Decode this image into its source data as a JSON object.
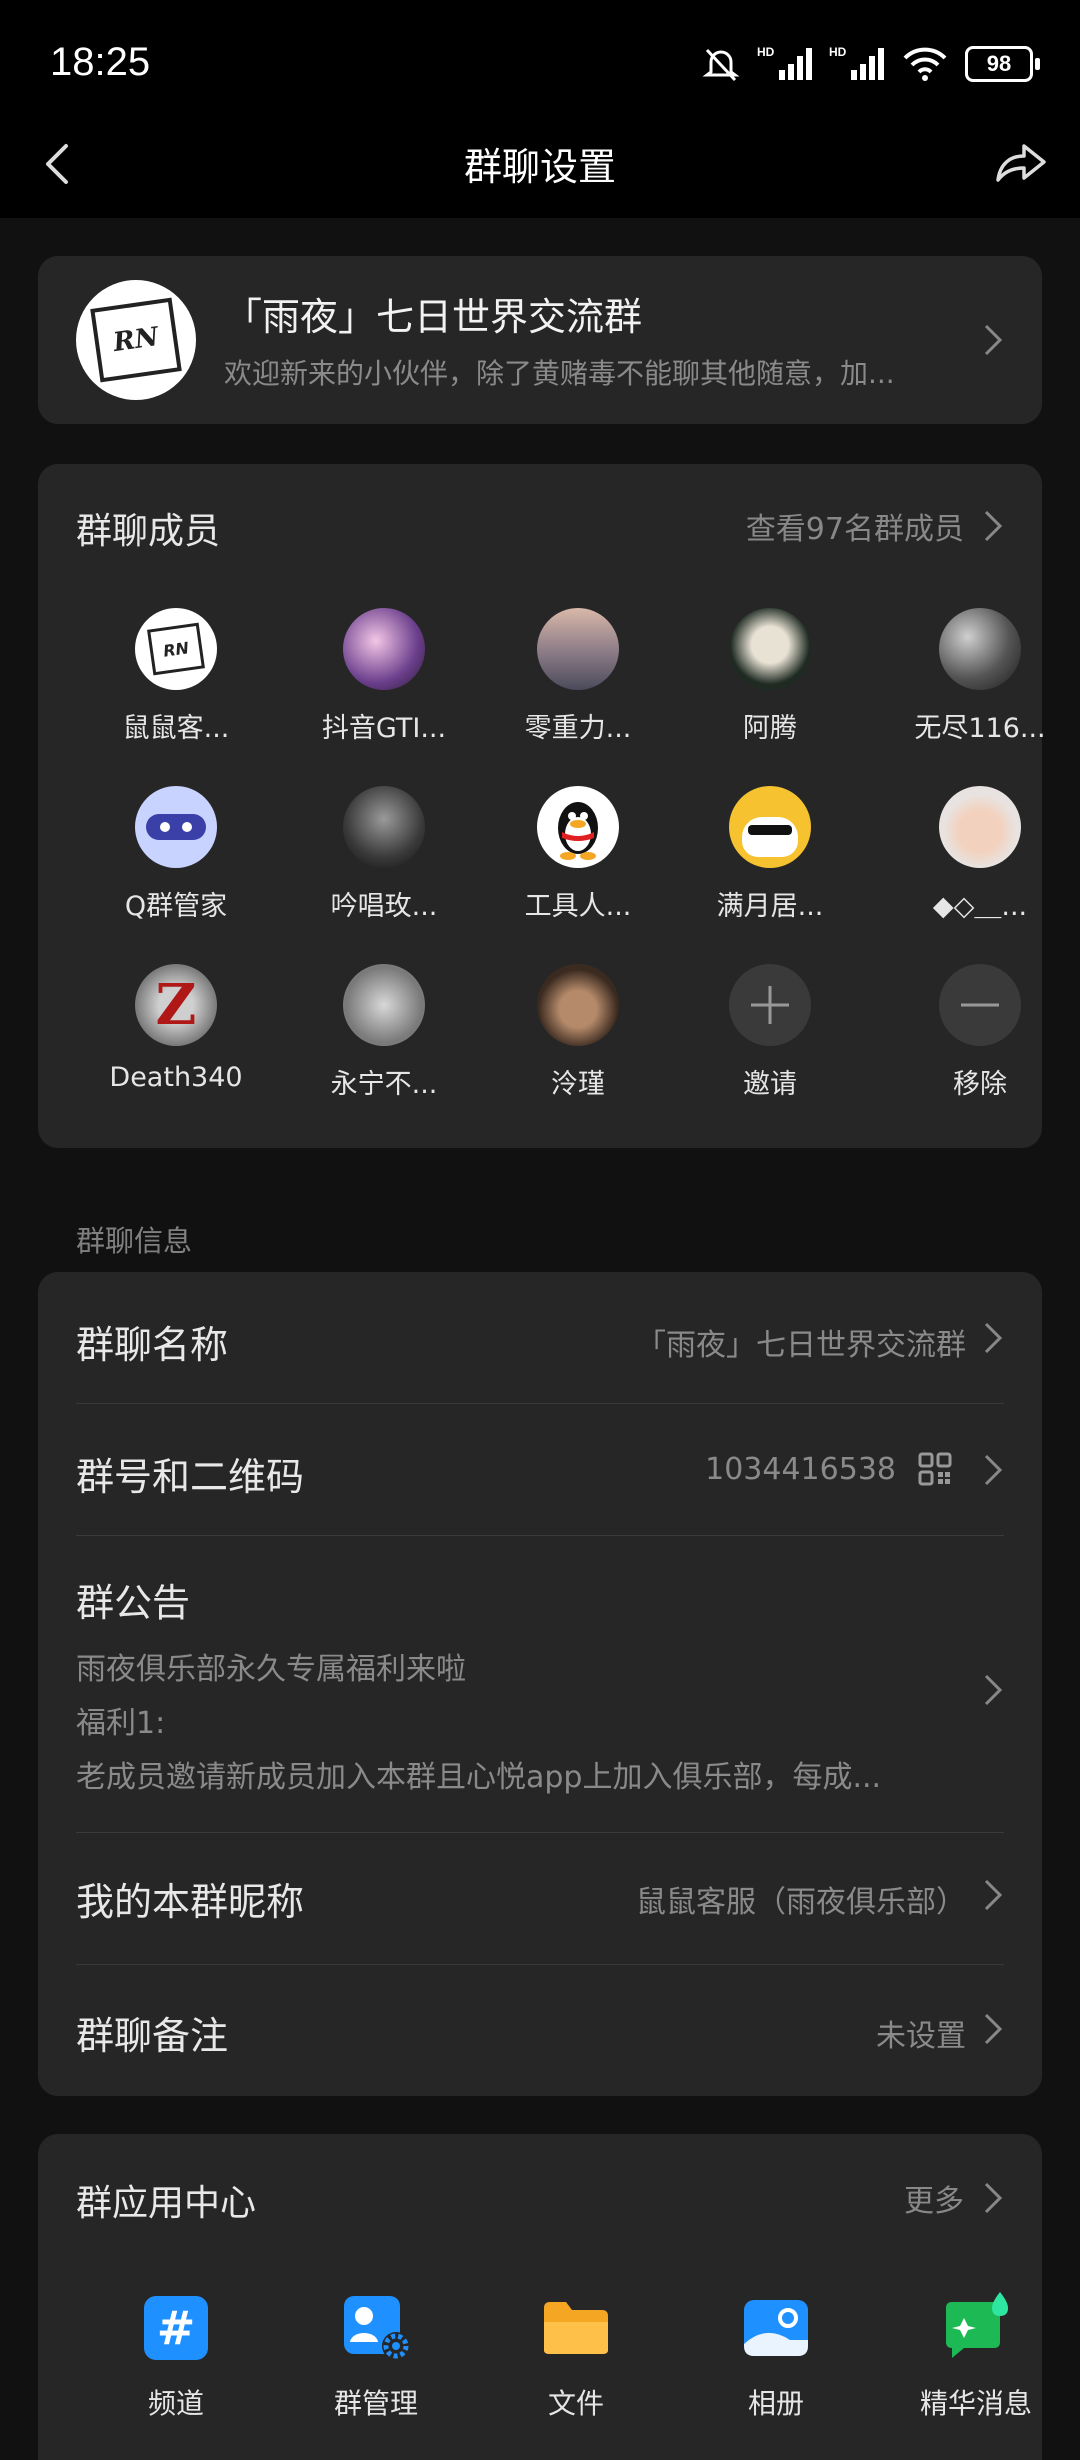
{
  "status_bar": {
    "time": "18:25",
    "battery": "98"
  },
  "nav": {
    "title": "群聊设置"
  },
  "group": {
    "name": "「雨夜」七日世界交流群",
    "description": "欢迎新来的小伙伴，除了黄赌毒不能聊其他随意，加...",
    "avatar_text": "RN"
  },
  "members": {
    "title": "群聊成员",
    "view_all": "查看97名群成员",
    "list": [
      {
        "label": "鼠鼠客..."
      },
      {
        "label": "抖音GTI..."
      },
      {
        "label": "零重力..."
      },
      {
        "label": "阿腾"
      },
      {
        "label": "无尽116..."
      },
      {
        "label": "Q群管家"
      },
      {
        "label": "吟唱玫..."
      },
      {
        "label": "工具人..."
      },
      {
        "label": "满月居..."
      },
      {
        "label": "◆◇＿..."
      },
      {
        "label": "Death340"
      },
      {
        "label": "永宁不..."
      },
      {
        "label": "泠瑾"
      },
      {
        "label": "邀请"
      },
      {
        "label": "移除"
      }
    ]
  },
  "info": {
    "caption": "群聊信息",
    "name_label": "群聊名称",
    "name_value": "「雨夜」七日世界交流群",
    "number_label": "群号和二维码",
    "number_value": "1034416538",
    "notice_label": "群公告",
    "notice_lines": [
      "雨夜俱乐部永久专属福利来啦",
      "福利1:",
      "老成员邀请新成员加入本群且心悦app上加入俱乐部，每成..."
    ],
    "nickname_label": "我的本群昵称",
    "nickname_value": "鼠鼠客服（雨夜俱乐部）",
    "remark_label": "群聊备注",
    "remark_value": "未设置"
  },
  "apps": {
    "title": "群应用中心",
    "more": "更多",
    "list": [
      {
        "label": "频道"
      },
      {
        "label": "群管理"
      },
      {
        "label": "文件"
      },
      {
        "label": "相册"
      },
      {
        "label": "精华消息"
      }
    ]
  },
  "colors": {
    "accent_blue": "#1e90ff",
    "folder_orange": "#f5a623",
    "green": "#1db954",
    "card": "#262626",
    "background": "#111111"
  }
}
